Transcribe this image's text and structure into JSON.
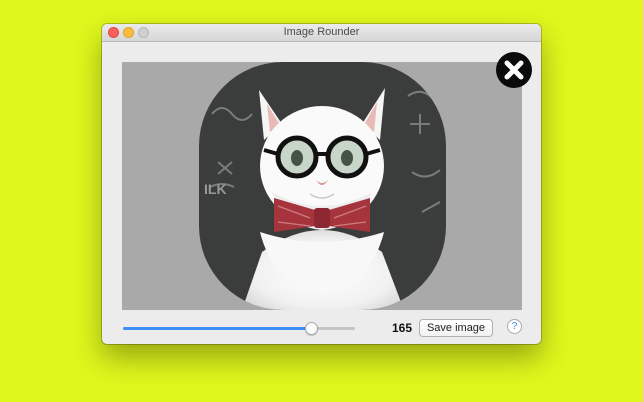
{
  "window": {
    "title": "Image Rounder"
  },
  "preview": {
    "image_description": "cat-with-glasses-and-bowtie",
    "rounded_corners": true,
    "background_color": "#a9a9a9"
  },
  "controls": {
    "radius_slider_fraction": 0.81,
    "radius_value": "165",
    "save_label": "Save image",
    "help_label": "?"
  },
  "icons": {
    "close_overlay": "close-icon",
    "window_close": "traffic-close",
    "window_minimize": "traffic-minimize",
    "window_zoom": "traffic-zoom"
  },
  "colors": {
    "page_background": "#dff71c",
    "slider_fill": "#3d8ef6",
    "window_background": "#ececec"
  }
}
